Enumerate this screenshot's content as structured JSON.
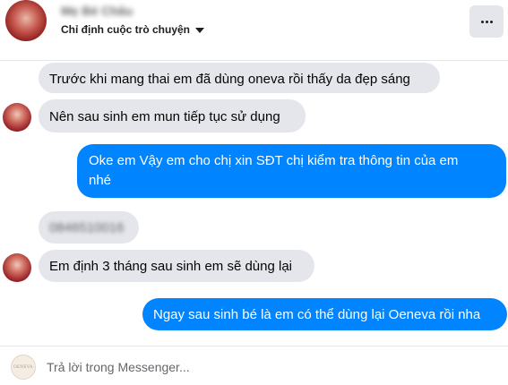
{
  "header": {
    "contact_name": "Mẹ Bé Châu",
    "subtitle": "Chỉ định cuộc trò chuyện",
    "more_icon": "more-horizontal-icon"
  },
  "messages": [
    {
      "side": "in",
      "text": "Trước khi mang thai em đã dùng oneva rồi thấy da đẹp sáng"
    },
    {
      "side": "in",
      "text": "Nên sau sinh em mun tiếp tục sử dụng"
    },
    {
      "side": "out",
      "line1": "Oke em Vậy em cho chị xin SĐT chị kiểm tra thông tin của em",
      "line2": "nhé"
    },
    {
      "side": "in",
      "text": "0846510016"
    },
    {
      "side": "in",
      "text": "Em định 3 tháng sau sinh em sẽ dùng lại"
    },
    {
      "side": "out",
      "text": "Ngay sau sinh bé là em có thể dùng lại Oeneva rồi nha"
    }
  ],
  "composer": {
    "placeholder": "Trả lời trong Messenger...",
    "logo_text": "OENEVA"
  },
  "colors": {
    "outgoing_bubble": "#0084ff",
    "incoming_bubble": "#e4e6eb",
    "text_primary": "#050505",
    "text_secondary": "#65676b"
  }
}
